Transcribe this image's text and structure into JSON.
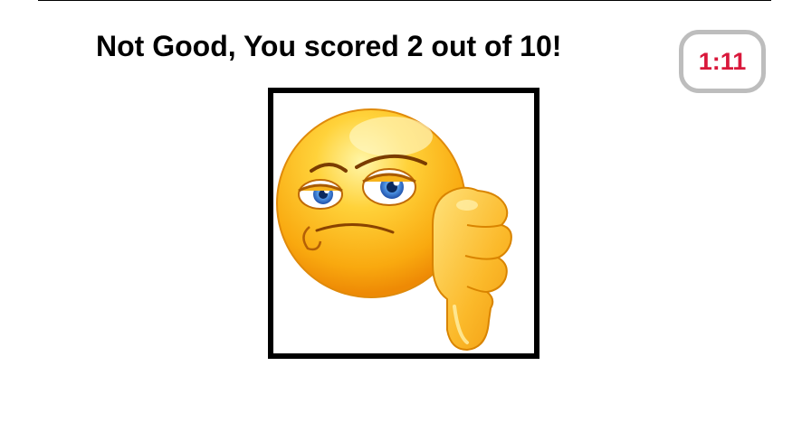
{
  "result": {
    "title": "Not Good, You scored 2 out of 10!"
  },
  "timer": {
    "value": "1:11"
  },
  "image": {
    "icon": "thumbs-down-emoji-icon"
  },
  "colors": {
    "timer_text": "#d9183b",
    "timer_border": "#bdbdbd",
    "frame_border": "#000000"
  }
}
